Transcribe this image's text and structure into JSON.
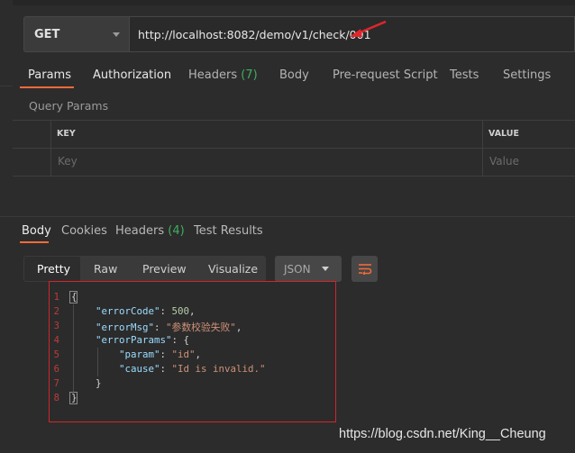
{
  "request": {
    "method": "GET",
    "url": "http://localhost:8082/demo/v1/check/001"
  },
  "request_tabs": [
    {
      "label": "Params",
      "count": ""
    },
    {
      "label": "Authorization",
      "count": ""
    },
    {
      "label": "Headers",
      "count": "(7)"
    },
    {
      "label": "Body",
      "count": ""
    },
    {
      "label": "Pre-request Script",
      "count": ""
    },
    {
      "label": "Tests",
      "count": ""
    },
    {
      "label": "Settings",
      "count": ""
    }
  ],
  "params": {
    "section_label": "Query Params",
    "col_key": "KEY",
    "col_value": "VALUE",
    "key_placeholder": "Key",
    "value_placeholder": "Value"
  },
  "response_tabs": [
    {
      "label": "Body",
      "count": ""
    },
    {
      "label": "Cookies",
      "count": ""
    },
    {
      "label": "Headers",
      "count": "(4)"
    },
    {
      "label": "Test Results",
      "count": ""
    }
  ],
  "view_modes": [
    "Pretty",
    "Raw",
    "Preview",
    "Visualize"
  ],
  "format": "JSON",
  "code_lines": [
    {
      "n": "1",
      "text": "{"
    },
    {
      "n": "2",
      "key": "\"errorCode\"",
      "val": "500",
      "type": "num",
      "trail": ","
    },
    {
      "n": "3",
      "key": "\"errorMsg\"",
      "val": "\"参数校验失败\"",
      "type": "str",
      "trail": ","
    },
    {
      "n": "4",
      "key": "\"errorParams\"",
      "val": "{",
      "type": "punct",
      "trail": ""
    },
    {
      "n": "5",
      "key": "\"param\"",
      "val": "\"id\"",
      "type": "str",
      "trail": ","
    },
    {
      "n": "6",
      "key": "\"cause\"",
      "val": "\"Id is invalid.\"",
      "type": "str",
      "trail": ""
    },
    {
      "n": "7",
      "text": "}"
    },
    {
      "n": "8",
      "text": "}"
    }
  ],
  "watermark": "https://blog.csdn.net/King__Cheung",
  "colors": {
    "accent": "#f26b3a",
    "count_green": "#3fae5f",
    "highlight_red": "#d0262b"
  }
}
